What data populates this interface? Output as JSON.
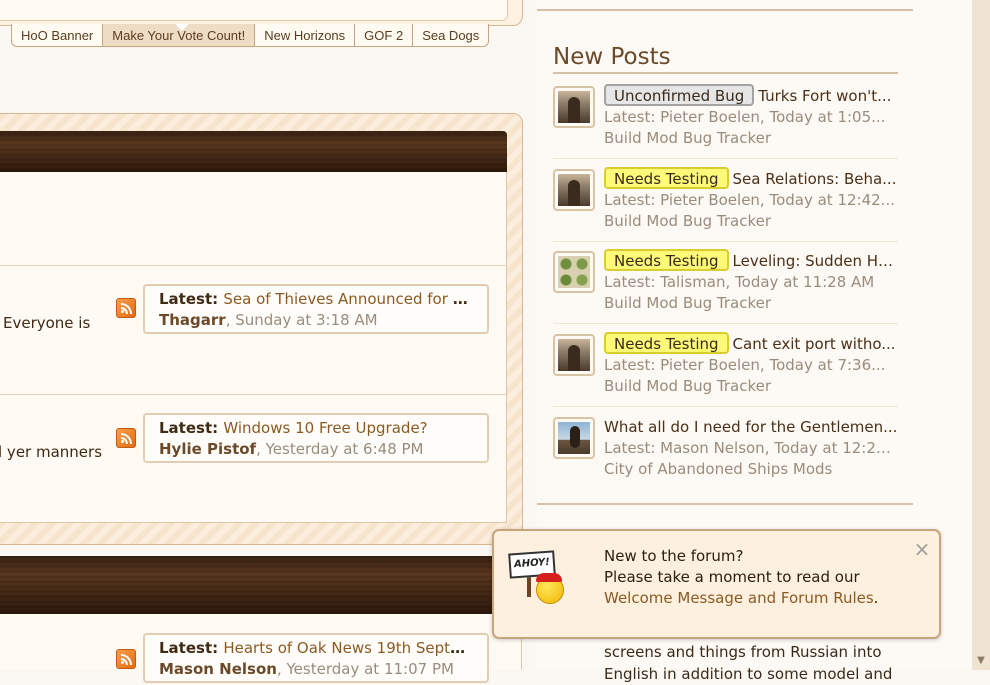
{
  "tabs": [
    {
      "label": "HoO Banner",
      "active": false
    },
    {
      "label": "Make Your Vote Count!",
      "active": true
    },
    {
      "label": "New Horizons",
      "active": false
    },
    {
      "label": "GOF 2",
      "active": false
    },
    {
      "label": "Sea Dogs",
      "active": false
    }
  ],
  "forums": [
    {
      "snippet": "Everyone is",
      "latest_prefix": "Latest:",
      "latest_title": "Sea of Thieves Announced for PC...",
      "user": "Thagarr",
      "time": "Sunday at 3:18 AM"
    },
    {
      "snippet": "l yer manners",
      "latest_prefix": "Latest:",
      "latest_title": "Windows 10 Free Upgrade?",
      "user": "Hylie Pistof",
      "time": "Yesterday at 6:48 PM"
    },
    {
      "snippet": "",
      "latest_prefix": "Latest:",
      "latest_title": "Hearts of Oak News 19th Septem...",
      "user": "Mason Nelson",
      "time": "Yesterday at 11:07 PM"
    }
  ],
  "sidebar": {
    "new_posts_title": "New Posts",
    "posts": [
      {
        "avatar": "man-avatar-icon",
        "prefix": "Unconfirmed Bug",
        "prefix_style": "gray",
        "title": "Turks Fort won't...",
        "latest": "Latest: Pieter Boelen, Today at 1:05...",
        "forum": "Build Mod Bug Tracker"
      },
      {
        "avatar": "man-avatar-icon",
        "prefix": "Needs Testing",
        "prefix_style": "yellow",
        "title": "Sea Relations: Beha...",
        "latest": "Latest: Pieter Boelen, Today at 12:42...",
        "forum": "Build Mod Bug Tracker"
      },
      {
        "avatar": "grid-avatar-icon",
        "prefix": "Needs Testing",
        "prefix_style": "yellow",
        "title": "Leveling: Sudden Hu...",
        "latest": "Latest: Talisman, Today at 11:28 AM",
        "forum": "Build Mod Bug Tracker"
      },
      {
        "avatar": "man-avatar-icon",
        "prefix": "Needs Testing",
        "prefix_style": "yellow",
        "title": "Cant exit port witho...",
        "latest": "Latest: Pieter Boelen, Today at 7:36...",
        "forum": "Build Mod Bug Tracker"
      },
      {
        "avatar": "rider-avatar-icon",
        "prefix": "",
        "prefix_style": "none",
        "title": "What all do I need for the Gentlemen...",
        "latest": "Latest: Mason Nelson, Today at 12:28...",
        "forum": "City of Abandoned Ships Mods"
      }
    ],
    "under_text": "screens and things from Russian into English in addition to some model and"
  },
  "notice": {
    "line1": "New to the forum?",
    "line2": "Please take a moment to read our",
    "link": "Welcome Message and Forum Rules",
    "after_link": ".",
    "close": "×",
    "sign": "AHOY!"
  },
  "colors": {
    "accent": "#8b5a23",
    "prefix_gray": "#e6e6e6",
    "prefix_yellow": "#fff97a",
    "background": "#fbf8f4"
  }
}
